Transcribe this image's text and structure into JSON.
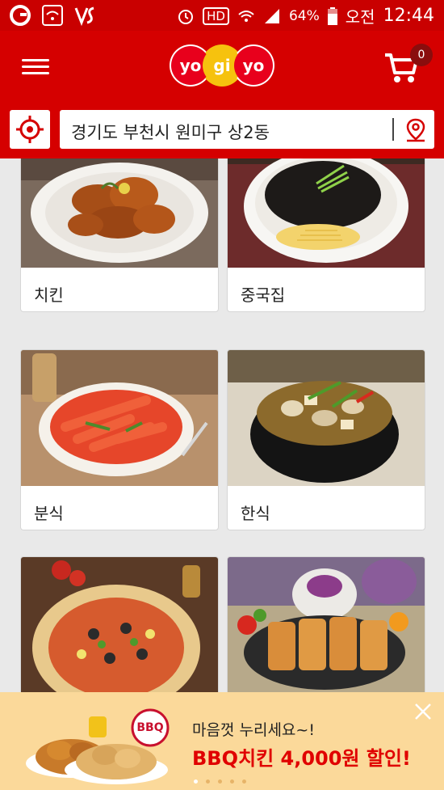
{
  "status_bar": {
    "battery": "64%",
    "ampm": "오전",
    "time": "12:44",
    "hd_label": "HD"
  },
  "header": {
    "cart_count": "0",
    "logo_parts": [
      "yo",
      "gi",
      "yo"
    ]
  },
  "search": {
    "address": "경기도 부천시 원미구 상2동"
  },
  "categories": [
    {
      "label": "치킨",
      "image": "fried-chicken-photo"
    },
    {
      "label": "중국집",
      "image": "jajangmyeon-photo"
    },
    {
      "label": "분식",
      "image": "tteokbokki-photo"
    },
    {
      "label": "한식",
      "image": "stew-photo"
    },
    {
      "label": "",
      "image": "pizza-photo"
    },
    {
      "label": "",
      "image": "tonkatsu-photo"
    }
  ],
  "banner": {
    "line1": "마음껏 누리세요~!",
    "line2": "BBQ치킨 4,000원 할인!",
    "logo_text": "BBQ Chicken"
  },
  "colors": {
    "brand_red": "#d50000",
    "status_red": "#c90000",
    "banner_bg": "#fbd99a"
  }
}
